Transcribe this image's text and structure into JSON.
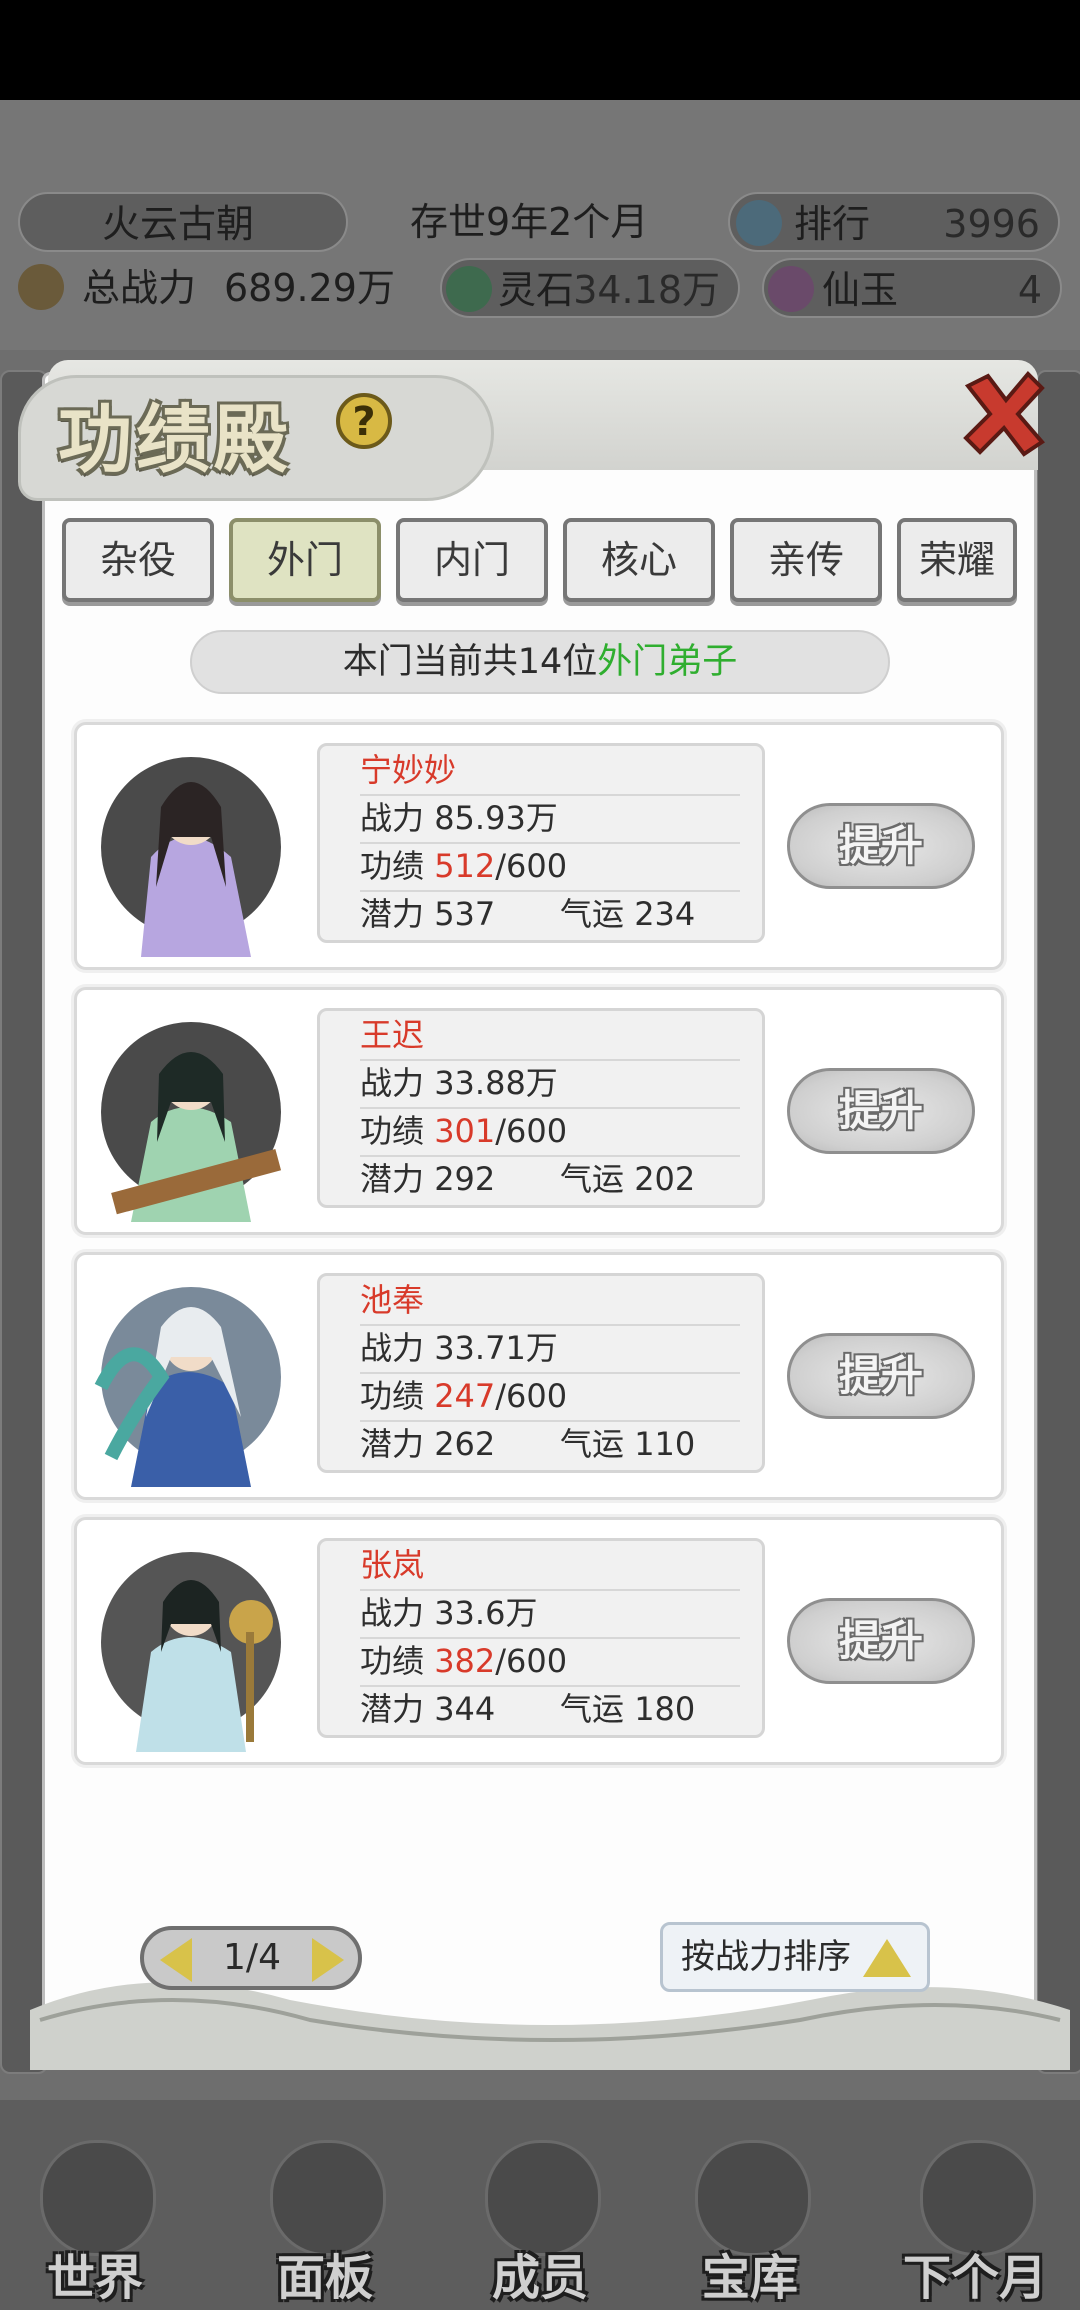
{
  "top_info": {
    "dynasty": "火云古朝",
    "age": "存世9年2个月",
    "rank_label": "排行",
    "rank_value": "3996",
    "power_label": "总战力",
    "power_value": "689.29万",
    "spirit_stone_label": "灵石",
    "spirit_stone_value": "34.18万",
    "jade_label": "仙玉",
    "jade_value": "4"
  },
  "modal": {
    "title": "功绩殿",
    "help_symbol": "?",
    "tabs": [
      {
        "label": "杂役",
        "active": false
      },
      {
        "label": "外门",
        "active": true
      },
      {
        "label": "内门",
        "active": false
      },
      {
        "label": "核心",
        "active": false
      },
      {
        "label": "亲传",
        "active": false
      },
      {
        "label": "荣耀",
        "active": false
      }
    ],
    "count_prefix": "本门当前共14位",
    "count_highlight": "外门弟子",
    "disciples": [
      {
        "name": "宁妙妙",
        "power_label": "战力",
        "power": "85.93万",
        "merit_label": "功绩",
        "merit": "512",
        "merit_max": "/600",
        "potential_label": "潜力",
        "potential": "537",
        "luck_label": "气运",
        "luck": "234",
        "button": "提升"
      },
      {
        "name": "王迟",
        "power_label": "战力",
        "power": "33.88万",
        "merit_label": "功绩",
        "merit": "301",
        "merit_max": "/600",
        "potential_label": "潜力",
        "potential": "292",
        "luck_label": "气运",
        "luck": "202",
        "button": "提升"
      },
      {
        "name": "池奉",
        "power_label": "战力",
        "power": "33.71万",
        "merit_label": "功绩",
        "merit": "247",
        "merit_max": "/600",
        "potential_label": "潜力",
        "potential": "262",
        "luck_label": "气运",
        "luck": "110",
        "button": "提升"
      },
      {
        "name": "张岚",
        "power_label": "战力",
        "power": "33.6万",
        "merit_label": "功绩",
        "merit": "382",
        "merit_max": "/600",
        "potential_label": "潜力",
        "potential": "344",
        "luck_label": "气运",
        "luck": "180",
        "button": "提升"
      }
    ],
    "pager": "1/4",
    "sort_label": "按战力排序"
  },
  "bottom_nav": [
    {
      "label": "世界"
    },
    {
      "label": "面板"
    },
    {
      "label": "成员"
    },
    {
      "label": "宝库"
    },
    {
      "label": "下个月"
    }
  ],
  "colors": {
    "highlight_green": "#2fae2f",
    "highlight_red": "#d83a2a"
  }
}
